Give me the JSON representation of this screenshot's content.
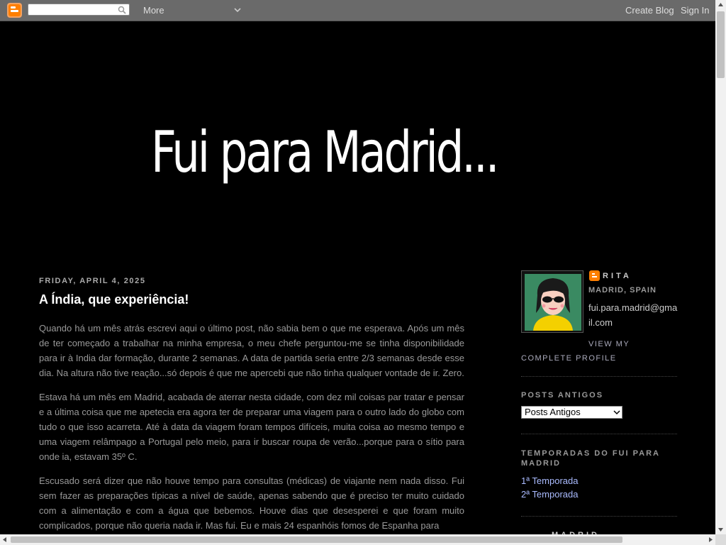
{
  "navbar": {
    "search_placeholder": "",
    "more_label": "More",
    "create_blog": "Create Blog",
    "sign_in": "Sign In"
  },
  "header": {
    "blog_title": "Fui para Madrid..."
  },
  "post": {
    "date": "Friday, April 4, 2025",
    "title": "A Índia, que experiência!",
    "paragraphs": [
      "Quando há um mês atrás escrevi aqui o último post, não sabia bem o que me esperava. Após um mês de ter começado a trabalhar na minha empresa, o meu chefe perguntou-me se tinha disponibilidade para ir à India dar formação, durante 2 semanas. A data de partida seria entre 2/3 semanas desde esse dia. Na altura não tive reação...só depois é que me apercebi que não tinha qualquer vontade de ir. Zero.",
      "Estava há um mês em Madrid, acabada de aterrar nesta cidade, com dez mil coisas par tratar e pensar e a última coisa que me apetecia era agora ter de preparar uma viagem para o outro lado do globo com tudo o que isso acarreta. Até à data da viagem foram tempos difíceis, muita coisa ao mesmo tempo e uma viagem relâmpago a Portugal pelo meio, para ir buscar roupa de verão...porque para o sítio para onde ia, estavam 35º C.",
      "Escusado será dizer que não houve tempo para consultas (médicas) de viajante nem nada disso. Fui sem fazer as preparações típicas a nível de saúde, apenas sabendo que é preciso ter muito cuidado com a alimentação e com a água que bebemos. Houve dias que desesperei e que foram muito complicados, porque não queria nada ir. Mas fui. Eu e mais 24 espanhóis fomos de Espanha para"
    ]
  },
  "sidebar": {
    "profile": {
      "name": "Rita",
      "location": "Madrid, Spain",
      "email": "fui.para.madrid@gmail.com",
      "view_profile": "View my complete profile"
    },
    "archive": {
      "title": "Posts Antigos",
      "selected": "Posts Antigos"
    },
    "seasons": {
      "title": "Temporadas do Fui para Madrid",
      "links": [
        "1ª Temporada",
        "2ª Temporada"
      ]
    },
    "next_widget_title": "Madrid"
  },
  "colors": {
    "background": "#000000",
    "navbar": "#6a6a6a",
    "blogger_orange": "#ff7f00",
    "link": "#aabbff"
  }
}
